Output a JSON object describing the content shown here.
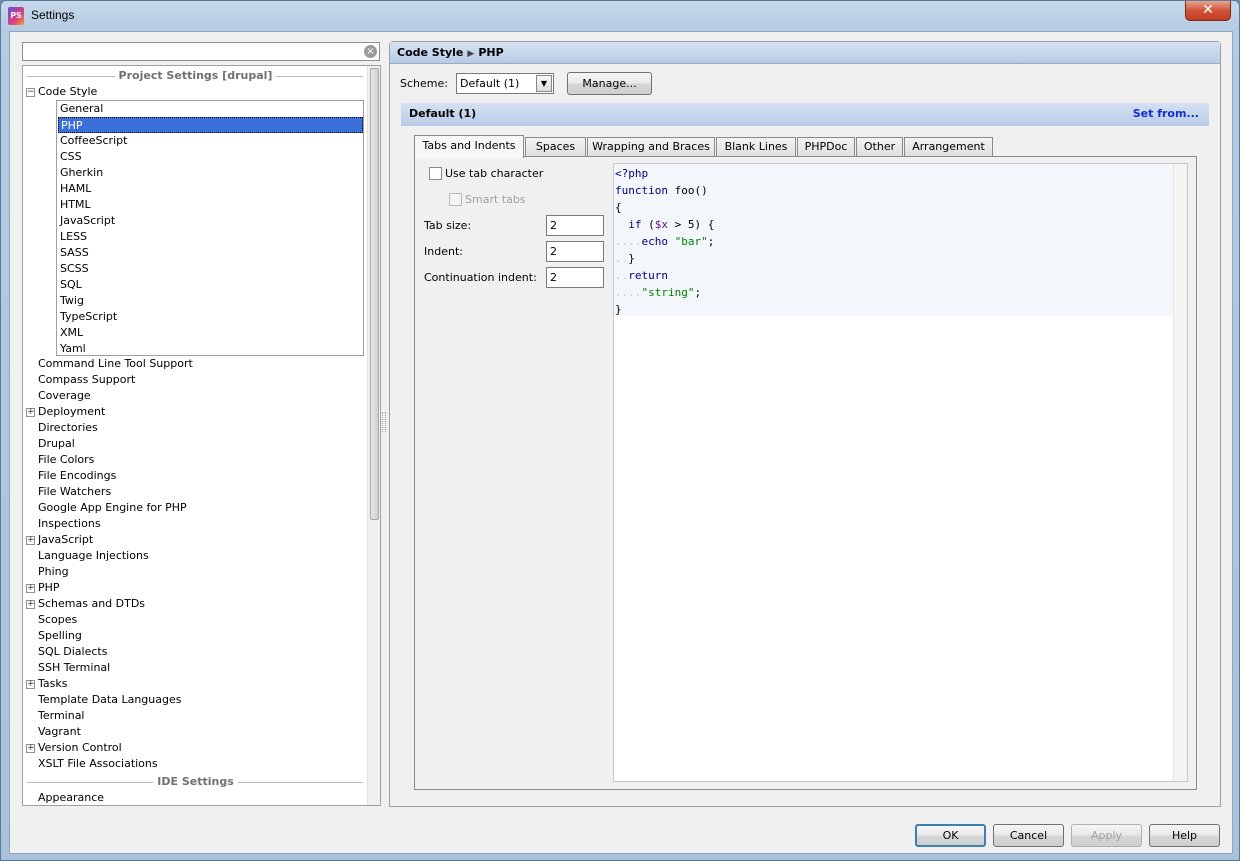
{
  "window": {
    "title": "Settings",
    "icon_label": "PS"
  },
  "search": {
    "value": "",
    "placeholder": ""
  },
  "tree": {
    "project_header": "Project Settings [drupal]",
    "ide_header": "IDE Settings",
    "code_style": "Code Style",
    "code_style_children": [
      "General",
      "PHP",
      "CoffeeScript",
      "CSS",
      "Gherkin",
      "HAML",
      "HTML",
      "JavaScript",
      "LESS",
      "SASS",
      "SCSS",
      "SQL",
      "Twig",
      "TypeScript",
      "XML",
      "Yaml"
    ],
    "selected_child": "PHP",
    "items": [
      {
        "label": "Command Line Tool Support",
        "expandable": false
      },
      {
        "label": "Compass Support",
        "expandable": false
      },
      {
        "label": "Coverage",
        "expandable": false
      },
      {
        "label": "Deployment",
        "expandable": true
      },
      {
        "label": "Directories",
        "expandable": false
      },
      {
        "label": "Drupal",
        "expandable": false
      },
      {
        "label": "File Colors",
        "expandable": false
      },
      {
        "label": "File Encodings",
        "expandable": false
      },
      {
        "label": "File Watchers",
        "expandable": false
      },
      {
        "label": "Google App Engine for PHP",
        "expandable": false
      },
      {
        "label": "Inspections",
        "expandable": false
      },
      {
        "label": "JavaScript",
        "expandable": true
      },
      {
        "label": "Language Injections",
        "expandable": false
      },
      {
        "label": "Phing",
        "expandable": false
      },
      {
        "label": "PHP",
        "expandable": true
      },
      {
        "label": "Schemas and DTDs",
        "expandable": true
      },
      {
        "label": "Scopes",
        "expandable": false
      },
      {
        "label": "Spelling",
        "expandable": false
      },
      {
        "label": "SQL Dialects",
        "expandable": false
      },
      {
        "label": "SSH Terminal",
        "expandable": false
      },
      {
        "label": "Tasks",
        "expandable": true
      },
      {
        "label": "Template Data Languages",
        "expandable": false
      },
      {
        "label": "Terminal",
        "expandable": false
      },
      {
        "label": "Vagrant",
        "expandable": false
      },
      {
        "label": "Version Control",
        "expandable": true
      },
      {
        "label": "XSLT File Associations",
        "expandable": false
      }
    ],
    "ide_items": [
      {
        "label": "Appearance",
        "expandable": false
      }
    ]
  },
  "breadcrumb": {
    "part1": "Code Style",
    "part2": "PHP"
  },
  "scheme": {
    "label": "Scheme:",
    "value": "Default (1)",
    "manage_button": "Manage..."
  },
  "section": {
    "title": "Default (1)",
    "set_from": "Set from..."
  },
  "tabs": [
    "Tabs and Indents",
    "Spaces",
    "Wrapping and Braces",
    "Blank Lines",
    "PHPDoc",
    "Other",
    "Arrangement"
  ],
  "active_tab": "Tabs and Indents",
  "options": {
    "use_tab_character": "Use tab character",
    "smart_tabs": "Smart tabs",
    "tab_size_label": "Tab size:",
    "tab_size": "2",
    "indent_label": "Indent:",
    "indent": "2",
    "continuation_label": "Continuation indent:",
    "continuation": "2"
  },
  "code_preview": [
    [
      {
        "t": "<?php",
        "c": "kw"
      }
    ],
    [
      {
        "t": "function",
        "c": "kw"
      },
      {
        "t": " foo()",
        "c": ""
      }
    ],
    [
      {
        "t": "{",
        "c": ""
      }
    ],
    [
      {
        "t": "  ",
        "c": "ws"
      },
      {
        "t": "if",
        "c": "kw"
      },
      {
        "t": " (",
        "c": ""
      },
      {
        "t": "$x",
        "c": "var"
      },
      {
        "t": " > 5) {",
        "c": ""
      }
    ],
    [
      {
        "t": "....",
        "c": "ws"
      },
      {
        "t": "echo",
        "c": "kw"
      },
      {
        "t": " ",
        "c": ""
      },
      {
        "t": "\"bar\"",
        "c": "str"
      },
      {
        "t": ";",
        "c": ""
      }
    ],
    [
      {
        "t": "..",
        "c": "ws"
      },
      {
        "t": "}",
        "c": ""
      }
    ],
    [
      {
        "t": "..",
        "c": "ws"
      },
      {
        "t": "return",
        "c": "kw"
      }
    ],
    [
      {
        "t": "....",
        "c": "ws"
      },
      {
        "t": "\"string\"",
        "c": "str"
      },
      {
        "t": ";",
        "c": ""
      }
    ],
    [
      {
        "t": "}",
        "c": ""
      }
    ]
  ],
  "buttons": {
    "ok": "OK",
    "cancel": "Cancel",
    "apply": "Apply",
    "help": "Help"
  },
  "colors": {
    "selection": "#3a6fd8",
    "link": "#1030d0",
    "keyword": "#000080",
    "string": "#008000"
  }
}
